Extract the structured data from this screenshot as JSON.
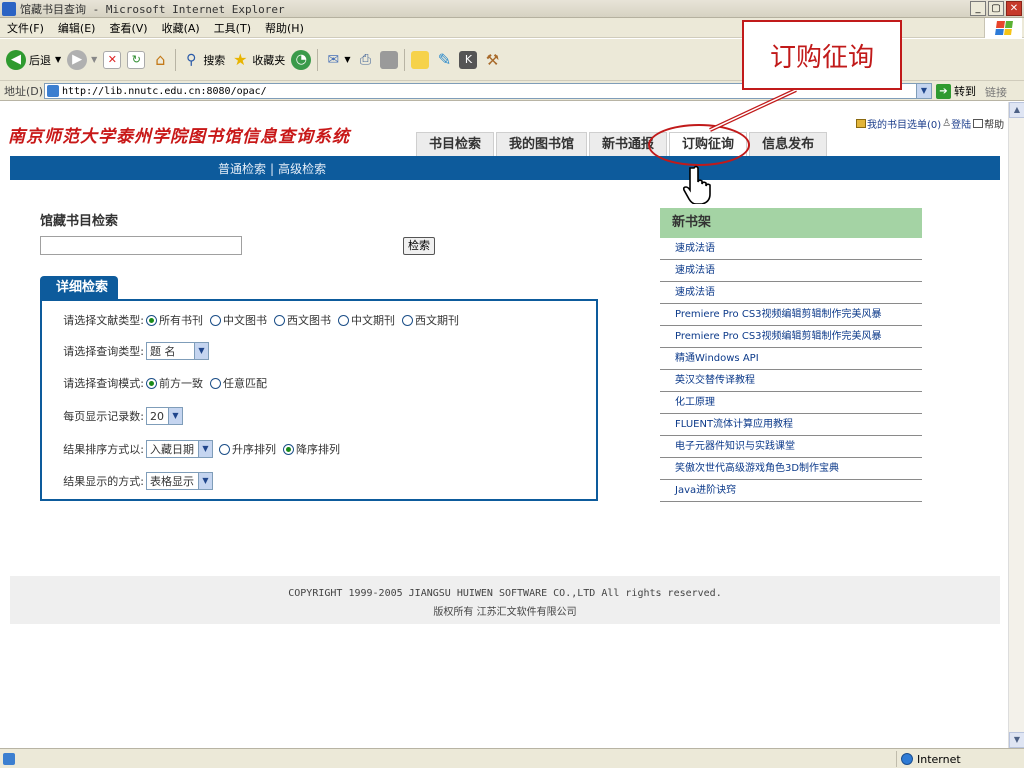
{
  "window": {
    "title": "馆藏书目查询 - Microsoft Internet Explorer"
  },
  "menubar": {
    "items": [
      "文件(F)",
      "编辑(E)",
      "查看(V)",
      "收藏(A)",
      "工具(T)",
      "帮助(H)"
    ]
  },
  "toolbar": {
    "back_label": "后退",
    "search_label": "搜索",
    "favorites_label": "收藏夹"
  },
  "address": {
    "label": "地址(D)",
    "url": "http://lib.nnutc.edu.cn:8080/opac/",
    "go_label": "转到",
    "links_label": "链接"
  },
  "page": {
    "site_title": "南京师范大学泰州学院图书馆信息查询系统",
    "tabs": [
      "书目检索",
      "我的图书馆",
      "新书通报",
      "订购征询",
      "信息发布"
    ],
    "top_links": {
      "shelf": "我的书目选单(0)",
      "login": "登陆",
      "help": "帮助"
    },
    "subnav": {
      "simple": "普通检索",
      "separator": "|",
      "advanced": "高级检索"
    },
    "callout_text": "订购征询",
    "search": {
      "title": "馆藏书目检索",
      "button": "检索",
      "detail_tab": "详细检索"
    },
    "rows": {
      "doc_type": {
        "label": "请选择文献类型:",
        "options": [
          "所有书刊",
          "中文图书",
          "西文图书",
          "中文期刊",
          "西文期刊"
        ]
      },
      "query_type": {
        "label": "请选择查询类型:",
        "value": "题 名"
      },
      "query_mode": {
        "label": "请选择查询模式:",
        "options": [
          "前方一致",
          "任意匹配"
        ]
      },
      "per_page": {
        "label": "每页显示记录数:",
        "value": "20"
      },
      "sort": {
        "label": "结果排序方式以:",
        "value": "入藏日期",
        "options": [
          "升序排列",
          "降序排列"
        ]
      },
      "display": {
        "label": "结果显示的方式:",
        "value": "表格显示"
      }
    },
    "new_books": {
      "title": "新书架",
      "items": [
        "速成法语",
        "速成法语",
        "速成法语",
        "Premiere Pro CS3视频编辑剪辑制作完美风暴",
        "Premiere Pro CS3视频编辑剪辑制作完美风暴",
        "精通Windows API",
        "英汉交替传译教程",
        "化工原理",
        "FLUENT流体计算应用教程",
        "电子元器件知识与实践课堂",
        "笑傲次世代高级游戏角色3D制作宝典",
        "Java进阶诀窍"
      ]
    },
    "footer": {
      "copyright": "COPYRIGHT 1999-2005 JIANGSU HUIWEN SOFTWARE CO.,LTD All rights reserved.",
      "rights": "版权所有 江苏汇文软件有限公司"
    }
  },
  "status": {
    "zone": "Internet"
  },
  "colors": {
    "site_title": "#c81818",
    "nav_bar": "#0d5b9c",
    "shelf_header": "#a4d3a4",
    "callout": "#c11a1a"
  }
}
